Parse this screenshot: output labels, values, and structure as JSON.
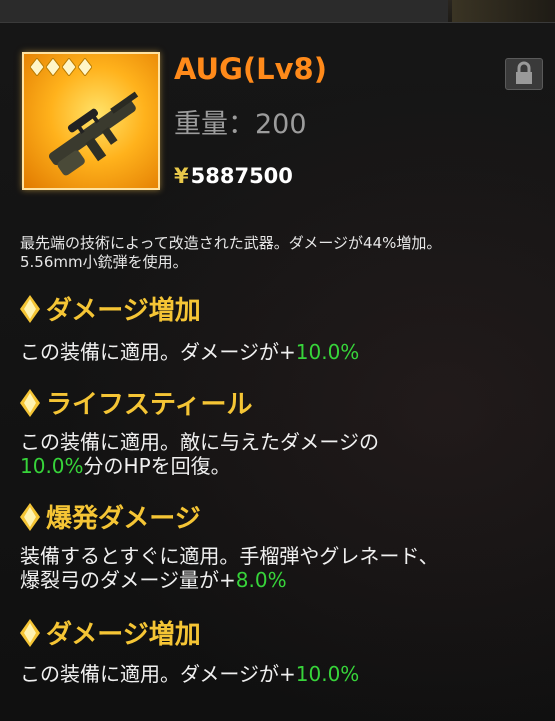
{
  "item": {
    "name": "AUG(Lv8)",
    "weight_label": "重量：200",
    "price_symbol": "¥",
    "price": "5887500",
    "stars": 4,
    "icon": "rifle-icon",
    "lock_icon": "lock-icon",
    "description_line1": "最先端の技術によって改造された武器。ダメージが44%増加。",
    "description_line2": "5.56mm小銃弾を使用。"
  },
  "effects": [
    {
      "title": "ダメージ増加",
      "line1_pre": "この装備に適用。ダメージが+",
      "line1_value": "10.0%"
    },
    {
      "title": "ライフスティール",
      "line1_pre": "この装備に適用。敵に与えたダメージの",
      "line2_value": "10.0%",
      "line2_post": "分のHPを回復。"
    },
    {
      "title": "爆発ダメージ",
      "line1_pre": "装備するとすぐに適用。手榴弾やグレネード、",
      "line2_pre": "爆裂弓のダメージ量が+",
      "line2_value": "8.0%"
    },
    {
      "title": "ダメージ増加",
      "line1_pre": "この装備に適用。ダメージが+",
      "line1_value": "10.0%"
    }
  ],
  "colors": {
    "title": "#ff8a1a",
    "section_heading": "#f5c535",
    "highlight": "#37d43a",
    "weight": "#9c9c9c"
  }
}
